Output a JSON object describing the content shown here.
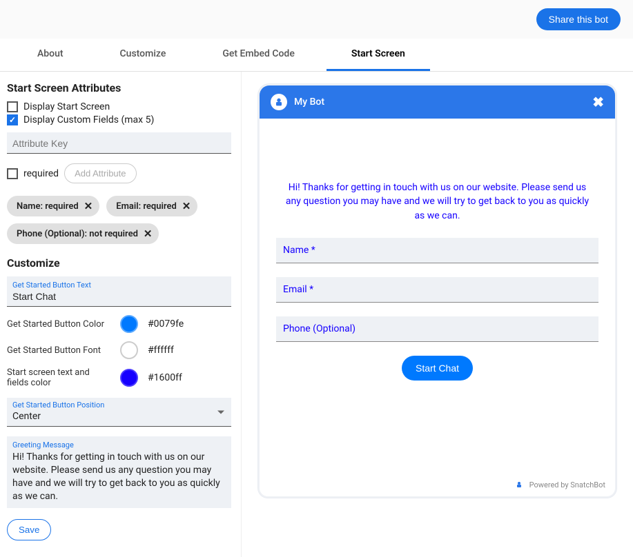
{
  "topbar": {
    "share_label": "Share this bot"
  },
  "tabs": [
    {
      "label": "About",
      "active": false
    },
    {
      "label": "Customize",
      "active": false
    },
    {
      "label": "Get Embed Code",
      "active": false
    },
    {
      "label": "Start Screen",
      "active": true
    }
  ],
  "sections": {
    "attributes_title": "Start Screen Attributes",
    "customize_title": "Customize"
  },
  "checkboxes": {
    "display_start_screen": {
      "label": "Display Start Screen",
      "checked": false
    },
    "display_custom_fields": {
      "label": "Display Custom Fields (max 5)",
      "checked": true
    }
  },
  "attr_key_input": {
    "placeholder": "Attribute Key",
    "value": ""
  },
  "required_checkbox": {
    "label": "required",
    "checked": false
  },
  "add_attribute_label": "Add Attribute",
  "chips": [
    {
      "text": "Name: required"
    },
    {
      "text": "Email: required"
    },
    {
      "text": "Phone (Optional): not required"
    }
  ],
  "customize": {
    "button_text_label": "Get Started Button Text",
    "button_text_value": "Start Chat",
    "button_color_label": "Get Started Button Color",
    "button_color_value": "#0079fe",
    "button_font_label": "Get Started Button Font",
    "button_font_value": "#ffffff",
    "fields_color_label": "Start screen text and fields color",
    "fields_color_value": "#1600ff",
    "position_label": "Get Started Button Position",
    "position_value": "Center",
    "greeting_label": "Greeting Message",
    "greeting_value": "Hi! Thanks for getting in touch with us on our website. Please send us any question you may have and we will try to get back to you as quickly as we can."
  },
  "save_label": "Save",
  "preview": {
    "bot_name": "My Bot",
    "greeting": "Hi! Thanks for getting in touch with us on our website. Please send us any question you may have and we will try to get back to you as quickly as we can.",
    "fields": [
      {
        "label": "Name *"
      },
      {
        "label": "Email *"
      },
      {
        "label": "Phone (Optional)"
      }
    ],
    "start_label": "Start Chat",
    "powered_by": "Powered by SnatchBot"
  }
}
